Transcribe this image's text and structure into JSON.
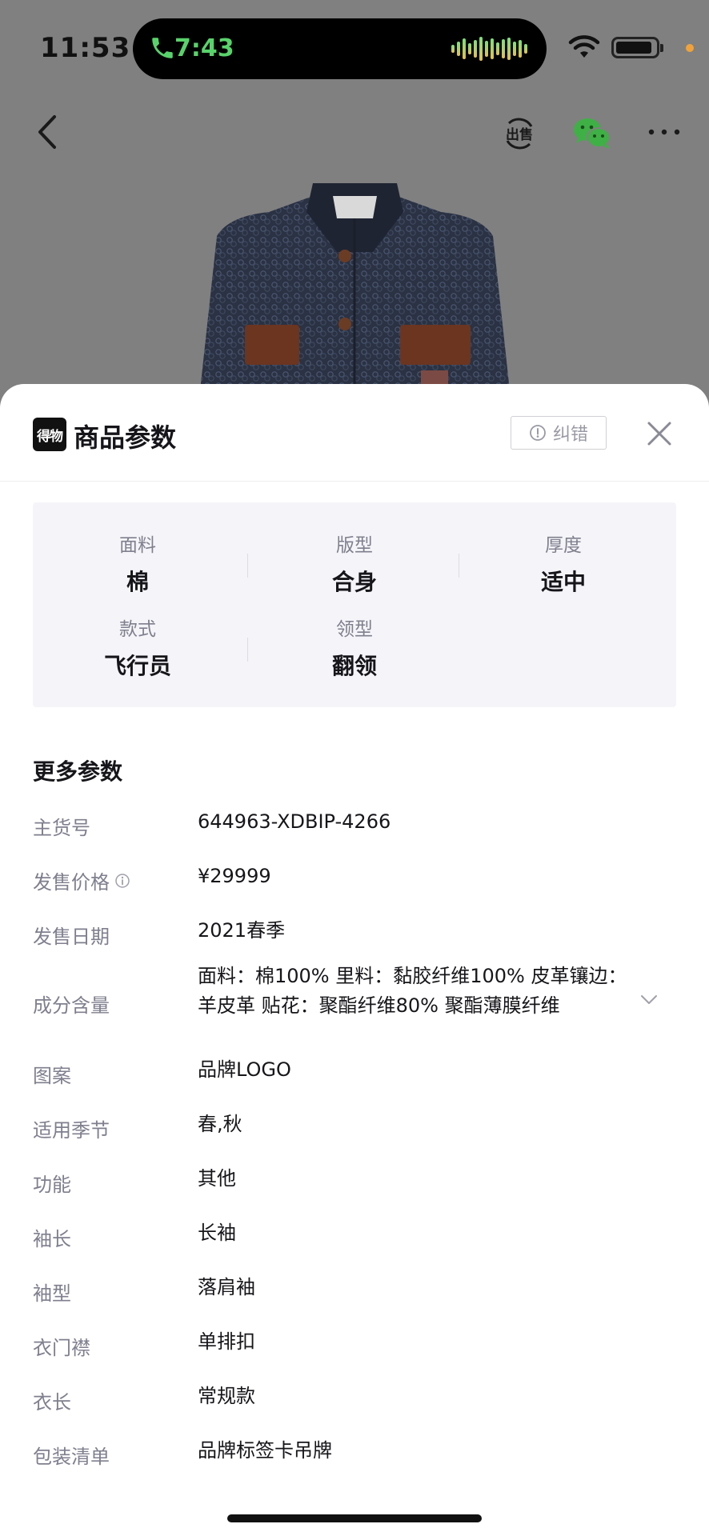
{
  "status_bar": {
    "time": "11:53",
    "call_time": "7:43"
  },
  "sheet": {
    "brand_logo_text": "得物",
    "title": "商品参数",
    "report_label": "纠错"
  },
  "key_params": [
    {
      "label": "面料",
      "value": "棉"
    },
    {
      "label": "版型",
      "value": "合身"
    },
    {
      "label": "厚度",
      "value": "适中"
    },
    {
      "label": "款式",
      "value": "飞行员"
    },
    {
      "label": "领型",
      "value": "翻领"
    }
  ],
  "more_params_title": "更多参数",
  "more_params": [
    {
      "label": "主货号",
      "value": "644963-XDBIP-4266"
    },
    {
      "label": "发售价格",
      "value": "¥29999"
    },
    {
      "label": "发售日期",
      "value": "2021春季"
    },
    {
      "label": "成分含量",
      "value": "面料：棉100%  里料：黏胶纤维100%  皮革镶边：羊皮革  贴花：聚酯纤维80% 聚酯薄膜纤维"
    },
    {
      "label": "图案",
      "value": "品牌LOGO"
    },
    {
      "label": "适用季节",
      "value": "春,秋"
    },
    {
      "label": "功能",
      "value": "其他"
    },
    {
      "label": "袖长",
      "value": "长袖"
    },
    {
      "label": "袖型",
      "value": "落肩袖"
    },
    {
      "label": "衣门襟",
      "value": "单排扣"
    },
    {
      "label": "衣长",
      "value": "常规款"
    },
    {
      "label": "包装清单",
      "value": "品牌标签卡吊牌"
    }
  ],
  "colors": {
    "accent_green": "#58d36b",
    "wechat_green": "#3fb045",
    "sheet_bg": "#ffffff",
    "panel_bg": "#f5f5f9"
  }
}
